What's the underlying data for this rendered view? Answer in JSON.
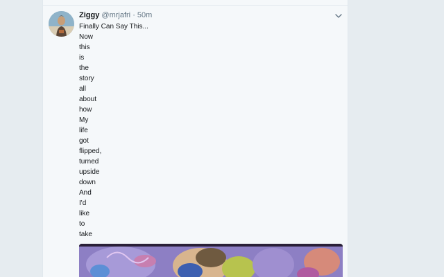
{
  "tweet": {
    "display_name": "Ziggy",
    "handle": "@mrjafri",
    "separator": "·",
    "timestamp": "50m",
    "lines": [
      "Finally Can Say This...",
      "Now",
      "this",
      "is",
      "the",
      "story",
      "all",
      "about",
      "how",
      "My",
      "life",
      "got",
      "flipped,",
      "turned",
      "upside",
      "down",
      "And",
      "I'd",
      "like",
      "to",
      "take"
    ],
    "icons": {
      "avatar": "profile-avatar",
      "menu": "chevron-down-icon"
    }
  },
  "colors": {
    "page_bg": "#e6ecf0",
    "timeline_bg": "#f5f8fa",
    "text_primary": "#14171a",
    "text_secondary": "#657786"
  }
}
